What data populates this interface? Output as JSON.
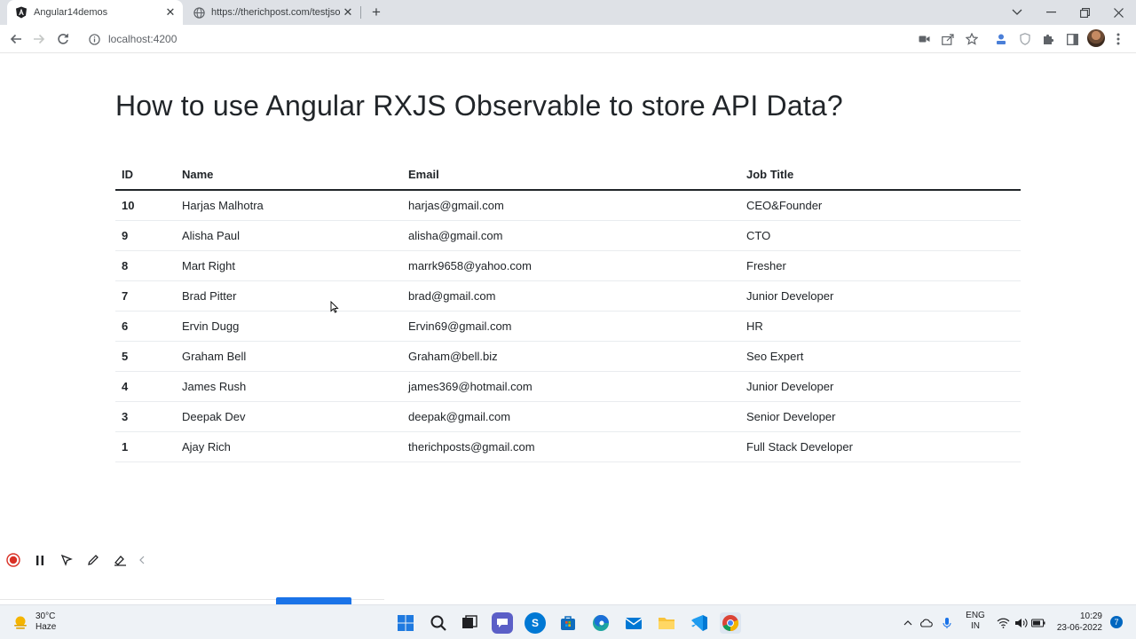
{
  "browser": {
    "tabs": [
      {
        "title": "Angular14demos",
        "active": true,
        "icon": "angular-icon"
      },
      {
        "title": "https://therichpost.com/testjson",
        "active": false,
        "icon": "globe-icon"
      }
    ],
    "url": "localhost:4200"
  },
  "page": {
    "title": "How to use Angular RXJS Observable to store API Data?",
    "columns": {
      "id": "ID",
      "name": "Name",
      "email": "Email",
      "job": "Job Title"
    },
    "rows": [
      {
        "id": "10",
        "name": "Harjas Malhotra",
        "email": "harjas@gmail.com",
        "job": "CEO&Founder"
      },
      {
        "id": "9",
        "name": "Alisha Paul",
        "email": "alisha@gmail.com",
        "job": "CTO"
      },
      {
        "id": "8",
        "name": "Mart Right",
        "email": "marrk9658@yahoo.com",
        "job": "Fresher"
      },
      {
        "id": "7",
        "name": "Brad Pitter",
        "email": "brad@gmail.com",
        "job": "Junior Developer"
      },
      {
        "id": "6",
        "name": "Ervin Dugg",
        "email": "Ervin69@gmail.com",
        "job": "HR"
      },
      {
        "id": "5",
        "name": "Graham Bell",
        "email": "Graham@bell.biz",
        "job": "Seo Expert"
      },
      {
        "id": "4",
        "name": "James Rush",
        "email": "james369@hotmail.com",
        "job": "Junior Developer"
      },
      {
        "id": "3",
        "name": "Deepak Dev",
        "email": "deepak@gmail.com",
        "job": "Senior Developer"
      },
      {
        "id": "1",
        "name": "Ajay Rich",
        "email": "therichposts@gmail.com",
        "job": "Full Stack Developer"
      }
    ]
  },
  "taskbar": {
    "weather_temp": "30°C",
    "weather_desc": "Haze",
    "lang_1": "ENG",
    "lang_2": "IN",
    "time": "10:29",
    "date": "23-06-2022",
    "notifications": "7"
  },
  "colors": {
    "accent": "#1a73e8",
    "record_red": "#d93025",
    "text_dark": "#212529"
  }
}
